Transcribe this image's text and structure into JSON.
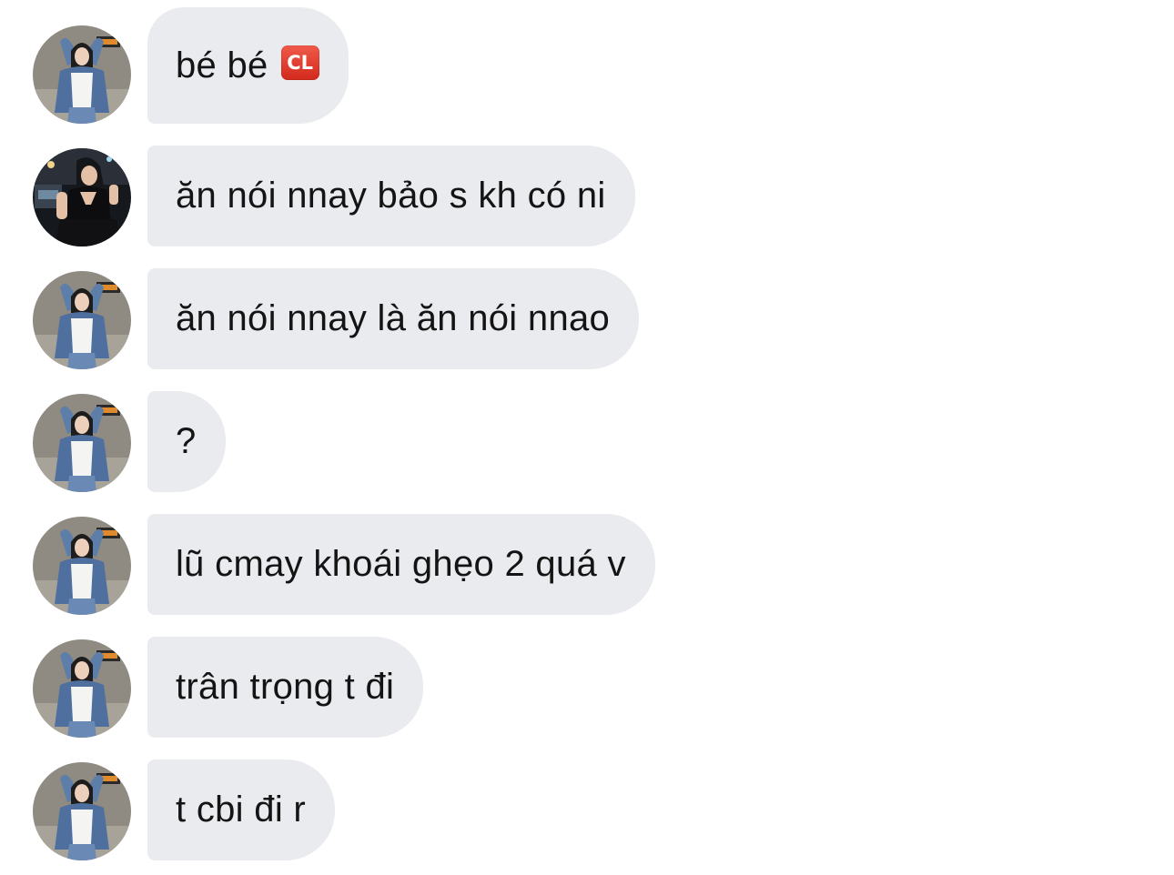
{
  "messages": [
    {
      "sender": "girl-denim",
      "text": "bé bé",
      "badge": "CL"
    },
    {
      "sender": "girl-black-dress",
      "text": "ăn nói nnay bảo s kh có ni"
    },
    {
      "sender": "girl-denim",
      "text": "ăn nói nnay là ăn nói nnao"
    },
    {
      "sender": "girl-denim",
      "text": "?"
    },
    {
      "sender": "girl-denim",
      "text": "lũ cmay khoái ghẹo 2 quá v"
    },
    {
      "sender": "girl-denim",
      "text": "trân trọng t đi"
    },
    {
      "sender": "girl-denim",
      "text": "t cbi đi r"
    }
  ],
  "icons": {
    "cl_badge": "squared-cl-emoji-icon",
    "avatar_a": "profile-photo-denim-jacket",
    "avatar_b": "profile-photo-black-dress"
  },
  "colors": {
    "bubble_bg": "#e9ebef",
    "text": "#141414",
    "badge_red": "#d2291c",
    "background": "#ffffff"
  }
}
